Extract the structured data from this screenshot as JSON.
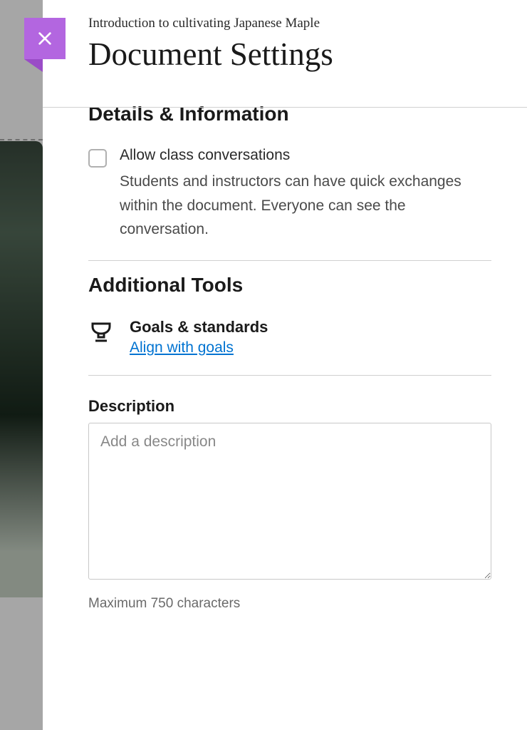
{
  "header": {
    "breadcrumb": "Introduction to cultivating Japanese Maple",
    "title": "Document Settings"
  },
  "sections": {
    "details": {
      "heading": "Details & Information",
      "allow_conversations": {
        "checked": false,
        "label": "Allow class conversations",
        "description": "Students and instructors can have quick exchanges within the document. Everyone can see the conversation."
      }
    },
    "tools": {
      "heading": "Additional Tools",
      "goals": {
        "title": "Goals & standards",
        "link_label": "Align with goals"
      }
    },
    "description": {
      "label": "Description",
      "placeholder": "Add a description",
      "value": "",
      "helper": "Maximum 750 characters"
    }
  }
}
